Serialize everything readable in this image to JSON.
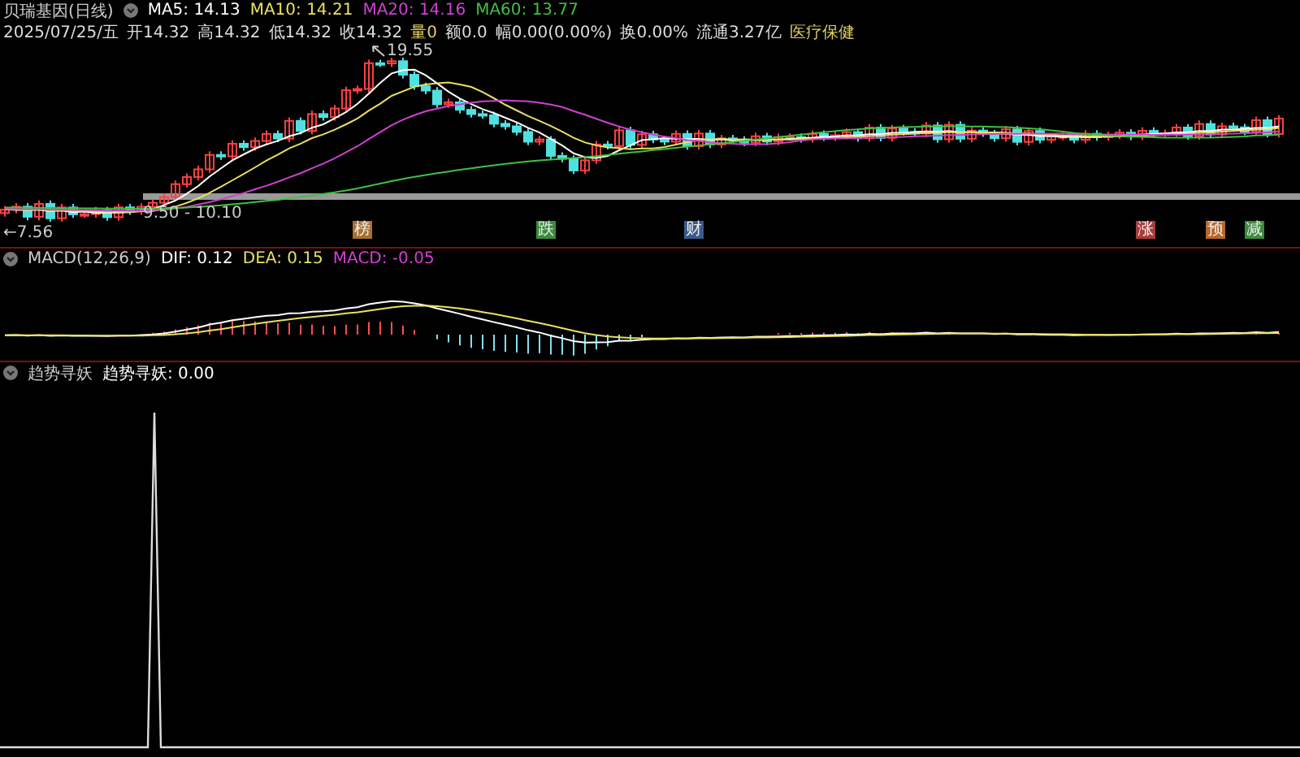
{
  "header": {
    "title": "贝瑞基因(日线)",
    "moving_averages": [
      {
        "label": "MA5: 14.13",
        "color": "#ffffff"
      },
      {
        "label": "MA10: 14.21",
        "color": "#e8e060"
      },
      {
        "label": "MA20: 14.16",
        "color": "#d040d0"
      },
      {
        "label": "MA60: 13.77",
        "color": "#40c040"
      }
    ]
  },
  "quote": [
    {
      "text": "2025/07/25/五",
      "color": "#dddddd"
    },
    {
      "text": "开14.32",
      "color": "#dddddd"
    },
    {
      "text": "高14.32",
      "color": "#dddddd"
    },
    {
      "text": "低14.32",
      "color": "#dddddd"
    },
    {
      "text": "收14.32",
      "color": "#dddddd"
    },
    {
      "text": "量0",
      "color": "#e0d060"
    },
    {
      "text": "额0.0",
      "color": "#dddddd"
    },
    {
      "text": "幅0.00(0.00%)",
      "color": "#dddddd"
    },
    {
      "text": "换0.00%",
      "color": "#dddddd"
    },
    {
      "text": "流通3.27亿",
      "color": "#dddddd"
    },
    {
      "text": "医疗保健",
      "color": "#e0d060"
    }
  ],
  "main_chart": {
    "annotations": [
      {
        "kind": "high",
        "text": "19.55"
      },
      {
        "kind": "range",
        "text": "9.50 - 10.10"
      },
      {
        "kind": "low",
        "text": "←7.56"
      }
    ],
    "events": [
      {
        "label": "榜",
        "color": "#a8702e"
      },
      {
        "label": "跌",
        "color": "#3c8c3c"
      },
      {
        "label": "财",
        "color": "#3a5a8c"
      },
      {
        "label": "涨",
        "color": "#a83c3c"
      },
      {
        "label": "预",
        "color": "#b8662a"
      },
      {
        "label": "减",
        "color": "#3c8c3c"
      }
    ]
  },
  "macd": {
    "title": "MACD(12,26,9)",
    "values": [
      {
        "label": "DIF: 0.12",
        "color": "#ffffff"
      },
      {
        "label": "DEA: 0.15",
        "color": "#e8e060"
      },
      {
        "label": "MACD: -0.05",
        "color": "#d040d0"
      }
    ]
  },
  "indicator": {
    "title": "趋势寻妖",
    "values": [
      {
        "label": "趋势寻妖: 0.00",
        "color": "#ffffff"
      }
    ]
  }
}
